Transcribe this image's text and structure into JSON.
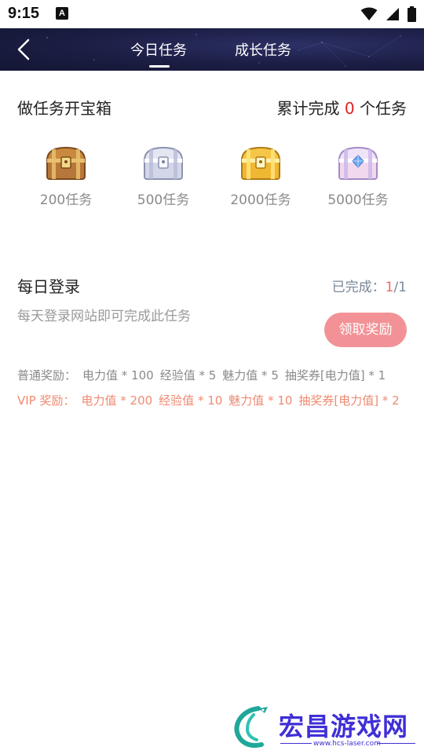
{
  "status_bar": {
    "time": "9:15",
    "notification_icon": "A"
  },
  "header": {
    "tabs": [
      {
        "label": "今日任务",
        "active": true
      },
      {
        "label": "成长任务",
        "active": false
      }
    ]
  },
  "treasure": {
    "title": "做任务开宝箱",
    "progress_prefix": "累计完成",
    "progress_count": "0",
    "progress_suffix": "个任务",
    "chests": [
      {
        "label": "200任务",
        "tier": "bronze"
      },
      {
        "label": "500任务",
        "tier": "silver"
      },
      {
        "label": "2000任务",
        "tier": "gold"
      },
      {
        "label": "5000任务",
        "tier": "diamond"
      }
    ]
  },
  "task": {
    "title": "每日登录",
    "status_prefix": "已完成：",
    "status_done": "1",
    "status_total": "/1",
    "description": "每天登录网站即可完成此任务",
    "claim_button": "领取奖励",
    "normal_reward_label": "普通奖励：",
    "normal_rewards": [
      "电力值 * 100",
      "经验值 * 5",
      "魅力值 * 5",
      "抽奖券[电力值] * 1"
    ],
    "vip_reward_label": "VIP 奖励：",
    "vip_rewards": [
      "电力值 * 200",
      "经验值 * 10",
      "魅力值 * 10",
      "抽奖券[电力值] * 2"
    ]
  },
  "watermark": {
    "title": "宏昌游戏网",
    "url": "www.hcs-laser.com"
  },
  "colors": {
    "header_bg": "#1b1d43",
    "accent_red": "#e02424",
    "claim_button": "#f39296",
    "vip_text": "#ef8a72",
    "watermark": "#3f2fd6"
  }
}
